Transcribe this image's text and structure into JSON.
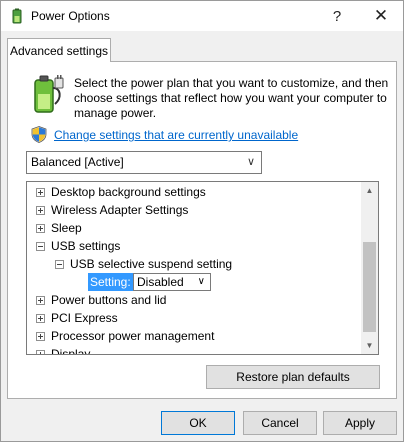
{
  "window": {
    "title": "Power Options",
    "help_label": "?",
    "close_label": "✕"
  },
  "tab": {
    "label": "Advanced settings"
  },
  "description": "Select the power plan that you want to customize, and then choose settings that reflect how you want your computer to manage power.",
  "change_link": "Change settings that are currently unavailable",
  "plan_select": {
    "value": "Balanced [Active]"
  },
  "tree": {
    "items": [
      {
        "label": "Desktop background settings",
        "expander": "+"
      },
      {
        "label": "Wireless Adapter Settings",
        "expander": "+"
      },
      {
        "label": "Sleep",
        "expander": "+"
      },
      {
        "label": "USB settings",
        "expander": "-"
      },
      {
        "label": "USB selective suspend setting",
        "expander": "-"
      },
      {
        "label": "Power buttons and lid",
        "expander": "+"
      },
      {
        "label": "PCI Express",
        "expander": "+"
      },
      {
        "label": "Processor power management",
        "expander": "+"
      },
      {
        "label": "Display",
        "expander": "+"
      }
    ],
    "setting": {
      "label": "Setting:",
      "value": "Disabled"
    }
  },
  "buttons": {
    "restore": "Restore plan defaults",
    "ok": "OK",
    "cancel": "Cancel",
    "apply": "Apply"
  },
  "icons": {
    "app": "power-options-icon",
    "battery": "battery-plug-icon",
    "shield": "uac-shield-icon"
  },
  "colors": {
    "link": "#0066cc",
    "selection": "#3399ff",
    "default_button_border": "#0078d7"
  }
}
